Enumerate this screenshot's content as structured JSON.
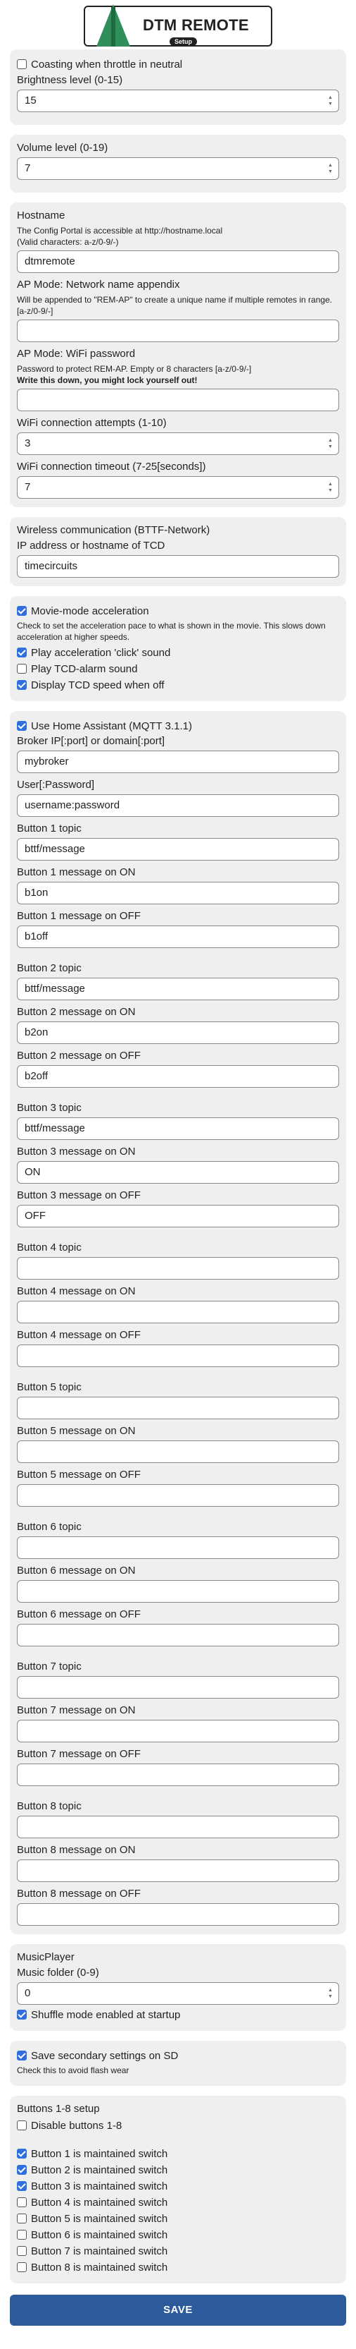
{
  "header": {
    "logo_title": "DTM REMOTE",
    "logo_sub": "Setup"
  },
  "colors": {
    "checkbox_checked": "#2f6fde",
    "save_button": "#2d5a9a",
    "section_bg": "#efefef",
    "logo_tree": "#2f8f5a"
  },
  "general": {
    "coasting_label": "Coasting when throttle in neutral",
    "coasting_checked": false,
    "brightness_label": "Brightness level (0-15)",
    "brightness_value": "15"
  },
  "volume": {
    "label": "Volume level (0-19)",
    "value": "7"
  },
  "network": {
    "hostname_label": "Hostname",
    "hostname_hint1": "The Config Portal is accessible at http://hostname.local",
    "hostname_hint2": "(Valid characters: a-z/0-9/-)",
    "hostname_value": "dtmremote",
    "ap_name_label": "AP Mode: Network name appendix",
    "ap_name_hint": "Will be appended to \"REM-AP\" to create a unique name if multiple remotes in range. [a-z/0-9/-]",
    "ap_name_value": "",
    "ap_pass_label": "AP Mode: WiFi password",
    "ap_pass_hint": "Password to protect REM-AP. Empty or 8 characters [a-z/0-9/-]",
    "ap_pass_warning": "Write this down, you might lock yourself out!",
    "ap_pass_value": "",
    "attempts_label": "WiFi connection attempts (1-10)",
    "attempts_value": "3",
    "timeout_label": "WiFi connection timeout (7-25[seconds])",
    "timeout_value": "7"
  },
  "bttf": {
    "title": "Wireless communication (BTTF-Network)",
    "ip_label": "IP address or hostname of TCD",
    "ip_value": "timecircuits"
  },
  "movie": {
    "accel_label": "Movie-mode acceleration",
    "accel_checked": true,
    "accel_hint": "Check to set the acceleration pace to what is shown in the movie. This slows down acceleration at higher speeds.",
    "click_label": "Play acceleration 'click' sound",
    "click_checked": true,
    "alarm_label": "Play TCD-alarm sound",
    "alarm_checked": false,
    "speed_label": "Display TCD speed when off",
    "speed_checked": true
  },
  "mqtt": {
    "use_label": "Use Home Assistant (MQTT 3.1.1)",
    "use_checked": true,
    "broker_label": "Broker IP[:port] or domain[:port]",
    "broker_value": "mybroker",
    "user_label": "User[:Password]",
    "user_value": "username:password",
    "buttons": [
      {
        "topic_label": "Button 1 topic",
        "topic": "bttf/message",
        "on_label": "Button 1 message on ON",
        "on": "b1on",
        "off_label": "Button 1 message on OFF",
        "off": "b1off"
      },
      {
        "topic_label": "Button 2 topic",
        "topic": "bttf/message",
        "on_label": "Button 2 message on ON",
        "on": "b2on",
        "off_label": "Button 2 message on OFF",
        "off": "b2off"
      },
      {
        "topic_label": "Button 3 topic",
        "topic": "bttf/message",
        "on_label": "Button 3 message on ON",
        "on": "ON",
        "off_label": "Button 3 message on OFF",
        "off": "OFF"
      },
      {
        "topic_label": "Button 4 topic",
        "topic": "",
        "on_label": "Button 4 message on ON",
        "on": "",
        "off_label": "Button 4 message on OFF",
        "off": ""
      },
      {
        "topic_label": "Button 5 topic",
        "topic": "",
        "on_label": "Button 5 message on ON",
        "on": "",
        "off_label": "Button 5 message on OFF",
        "off": ""
      },
      {
        "topic_label": "Button 6 topic",
        "topic": "",
        "on_label": "Button 6 message on ON",
        "on": "",
        "off_label": "Button 6 message on OFF",
        "off": ""
      },
      {
        "topic_label": "Button 7 topic",
        "topic": "",
        "on_label": "Button 7 message on ON",
        "on": "",
        "off_label": "Button 7 message on OFF",
        "off": ""
      },
      {
        "topic_label": "Button 8 topic",
        "topic": "",
        "on_label": "Button 8 message on ON",
        "on": "",
        "off_label": "Button 8 message on OFF",
        "off": ""
      }
    ]
  },
  "music": {
    "title": "MusicPlayer",
    "folder_label": "Music folder (0-9)",
    "folder_value": "0",
    "shuffle_label": "Shuffle mode enabled at startup",
    "shuffle_checked": true
  },
  "sd": {
    "label": "Save secondary settings on SD",
    "checked": true,
    "hint": "Check this to avoid flash wear"
  },
  "buttons_setup": {
    "title": "Buttons 1-8 setup",
    "disable_label": "Disable buttons 1-8",
    "disable_checked": false,
    "items": [
      {
        "label": "Button 1 is maintained switch",
        "checked": true
      },
      {
        "label": "Button 2 is maintained switch",
        "checked": true
      },
      {
        "label": "Button 3 is maintained switch",
        "checked": true
      },
      {
        "label": "Button 4 is maintained switch",
        "checked": false
      },
      {
        "label": "Button 5 is maintained switch",
        "checked": false
      },
      {
        "label": "Button 6 is maintained switch",
        "checked": false
      },
      {
        "label": "Button 7 is maintained switch",
        "checked": false
      },
      {
        "label": "Button 8 is maintained switch",
        "checked": false
      }
    ]
  },
  "save_label": "SAVE"
}
